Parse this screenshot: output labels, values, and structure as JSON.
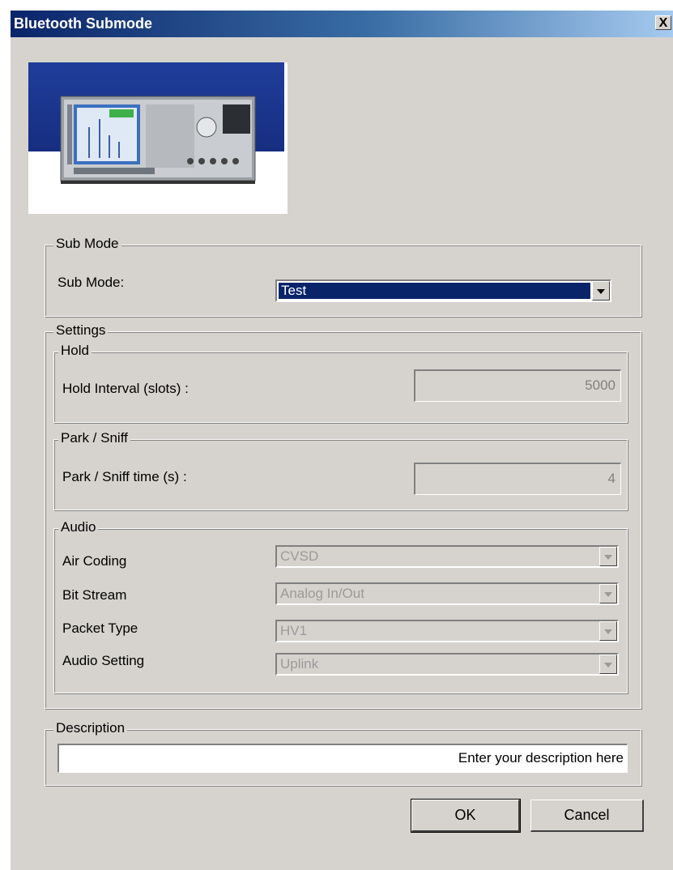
{
  "window": {
    "title": "Bluetooth Submode",
    "close_label": "X"
  },
  "sub_mode": {
    "group_title": "Sub Mode",
    "label": "Sub Mode:",
    "value": "Test"
  },
  "settings": {
    "group_title": "Settings",
    "hold": {
      "group_title": "Hold",
      "label": "Hold Interval (slots) :",
      "value": "5000"
    },
    "park_sniff": {
      "group_title": "Park / Sniff",
      "label": "Park / Sniff time (s) :",
      "value": "4"
    },
    "audio": {
      "group_title": "Audio",
      "rows": [
        {
          "label": "Air Coding",
          "value": "CVSD"
        },
        {
          "label": "Bit Stream",
          "value": "Analog In/Out"
        },
        {
          "label": "Packet Type",
          "value": "HV1"
        },
        {
          "label": "Audio Setting",
          "value": "Uplink"
        }
      ]
    }
  },
  "description": {
    "group_title": "Description",
    "value": "Enter your description here"
  },
  "buttons": {
    "ok": "OK",
    "cancel": "Cancel"
  },
  "colors": {
    "title_gradient_start": "#0b246a",
    "dialog_bg": "#d6d3ce",
    "selection": "#0a246a"
  },
  "icons": {
    "close": "close-icon",
    "dropdown": "chevron-down-icon"
  }
}
